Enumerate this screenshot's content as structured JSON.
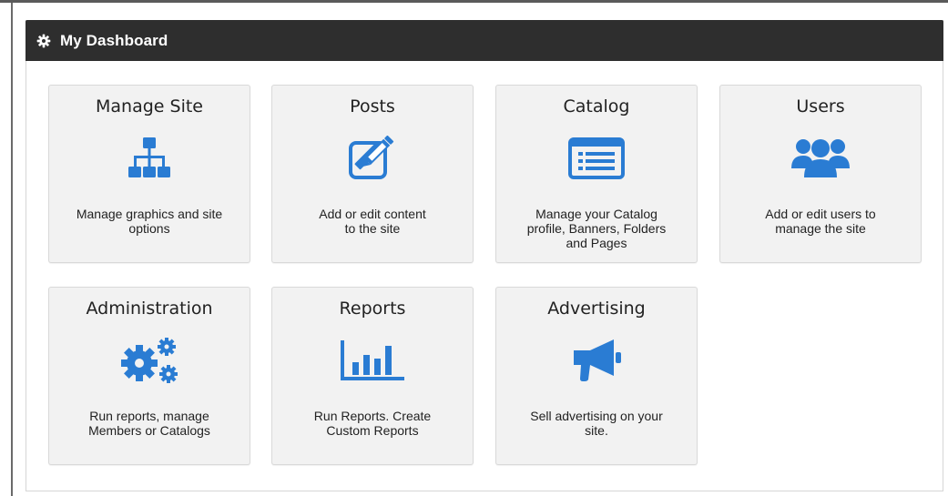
{
  "header": {
    "title": "My Dashboard",
    "icon": "gear-icon"
  },
  "colors": {
    "header_bg": "#2e2e2e",
    "icon_blue": "#2a7cd3",
    "tile_bg": "#f2f2f2"
  },
  "tiles": [
    {
      "title": "Manage Site",
      "icon": "sitemap-icon",
      "desc": [
        "Manage graphics and site",
        "options"
      ]
    },
    {
      "title": "Posts",
      "icon": "edit-icon",
      "desc": [
        "Add or edit content",
        "to the site"
      ]
    },
    {
      "title": "Catalog",
      "icon": "list-icon",
      "desc": [
        "Manage your Catalog",
        "profile, Banners, Folders",
        "and Pages"
      ]
    },
    {
      "title": "Users",
      "icon": "users-icon",
      "desc": [
        "Add or edit users to",
        "manage the site"
      ]
    },
    {
      "title": "Administration",
      "icon": "gears-icon",
      "desc": [
        "Run reports, manage",
        "Members or Catalogs"
      ]
    },
    {
      "title": "Reports",
      "icon": "bar-chart-icon",
      "desc": [
        "Run Reports. Create",
        "Custom Reports"
      ]
    },
    {
      "title": "Advertising",
      "icon": "megaphone-icon",
      "desc": [
        "Sell advertising on your",
        "site."
      ]
    }
  ]
}
